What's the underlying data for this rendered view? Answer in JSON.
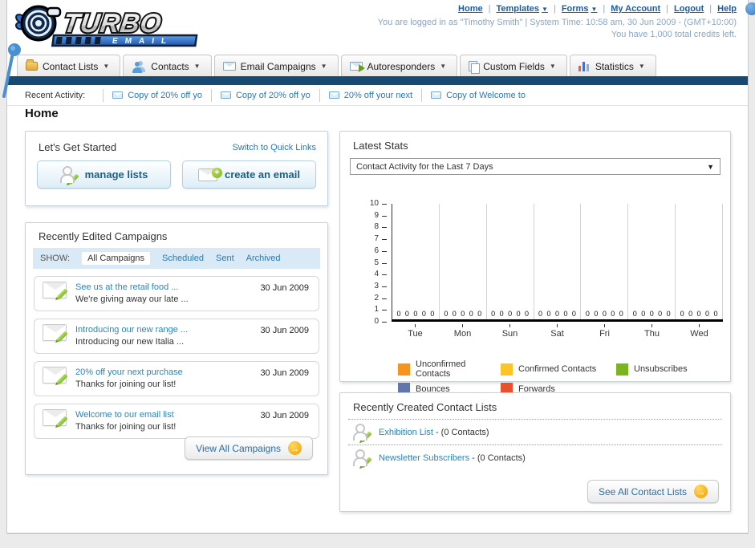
{
  "brand": {
    "name": "TURBO",
    "sub": "EMAIL"
  },
  "header": {
    "links": [
      {
        "label": "Home",
        "dropdown": false
      },
      {
        "label": "Templates",
        "dropdown": true
      },
      {
        "label": "Forms",
        "dropdown": true
      },
      {
        "label": "My Account",
        "dropdown": false
      },
      {
        "label": "Logout",
        "dropdown": false
      },
      {
        "label": "Help",
        "dropdown": false
      }
    ],
    "login_line": "You are logged in as \"Timothy Smith\" | System Time: 10:58 am, 30 Jun 2009 - (GMT+10:00)",
    "credits_line": "You have 1,000 total credits left."
  },
  "nav_tabs": [
    {
      "label": "Contact Lists"
    },
    {
      "label": "Contacts"
    },
    {
      "label": "Email Campaigns"
    },
    {
      "label": "Autoresponders"
    },
    {
      "label": "Custom Fields"
    },
    {
      "label": "Statistics"
    }
  ],
  "recent_activity": {
    "label": "Recent Activity:",
    "items": [
      "Copy of 20% off yo",
      "Copy of 20% off yo",
      "20% off your next",
      "Copy of Welcome to"
    ]
  },
  "page_title": "Home",
  "get_started": {
    "title": "Let's Get Started",
    "switch_link": "Switch to Quick Links",
    "buttons": [
      {
        "label": "manage lists"
      },
      {
        "label": "create an email"
      }
    ]
  },
  "campaigns": {
    "title": "Recently Edited Campaigns",
    "show_label": "SHOW:",
    "filters": [
      "All Campaigns",
      "Scheduled",
      "Sent",
      "Archived"
    ],
    "active_filter": "All Campaigns",
    "items": [
      {
        "title": "See us at the retail food ...",
        "subtitle": "We're giving away our late ...",
        "date": "30 Jun 2009"
      },
      {
        "title": "Introducing our new range ...",
        "subtitle": "Introducing our new Italia ...",
        "date": "30 Jun 2009"
      },
      {
        "title": "20% off your next purchase",
        "subtitle": "Thanks for joining our list!",
        "date": "30 Jun 2009"
      },
      {
        "title": "Welcome to our email list",
        "subtitle": "Thanks for joining our list!",
        "date": "30 Jun 2009"
      }
    ],
    "view_all_label": "View All Campaigns"
  },
  "stats": {
    "title": "Latest Stats",
    "dropdown_value": "Contact Activity for the Last 7 Days"
  },
  "chart_data": {
    "type": "bar",
    "title": "Contact Activity for the Last 7 Days",
    "categories": [
      "Tue",
      "Mon",
      "Sun",
      "Sat",
      "Fri",
      "Thu",
      "Wed"
    ],
    "series": [
      {
        "name": "Unconfirmed Contacts",
        "color": "#f7941d",
        "values": [
          0,
          0,
          0,
          0,
          0,
          0,
          0
        ]
      },
      {
        "name": "Confirmed Contacts",
        "color": "#fdc426",
        "values": [
          0,
          0,
          0,
          0,
          0,
          0,
          0
        ]
      },
      {
        "name": "Unsubscribes",
        "color": "#7ab51d",
        "values": [
          0,
          0,
          0,
          0,
          0,
          0,
          0
        ]
      },
      {
        "name": "Bounces",
        "color": "#6276ab",
        "values": [
          0,
          0,
          0,
          0,
          0,
          0,
          0
        ]
      },
      {
        "name": "Forwards",
        "color": "#e8502e",
        "values": [
          0,
          0,
          0,
          0,
          0,
          0,
          0
        ]
      }
    ],
    "ylim": [
      0,
      10
    ],
    "yticks": [
      0,
      1,
      2,
      3,
      4,
      5,
      6,
      7,
      8,
      9,
      10
    ],
    "grid": "vertical",
    "legend_position": "bottom",
    "value_labels": true
  },
  "contact_lists": {
    "title": "Recently Created Contact Lists",
    "items": [
      {
        "name": "Exhibition List",
        "detail": "- (0 Contacts)"
      },
      {
        "name": "Newsletter Subscribers",
        "detail": "- (0 Contacts)"
      }
    ],
    "see_all_label": "See All Contact Lists"
  }
}
